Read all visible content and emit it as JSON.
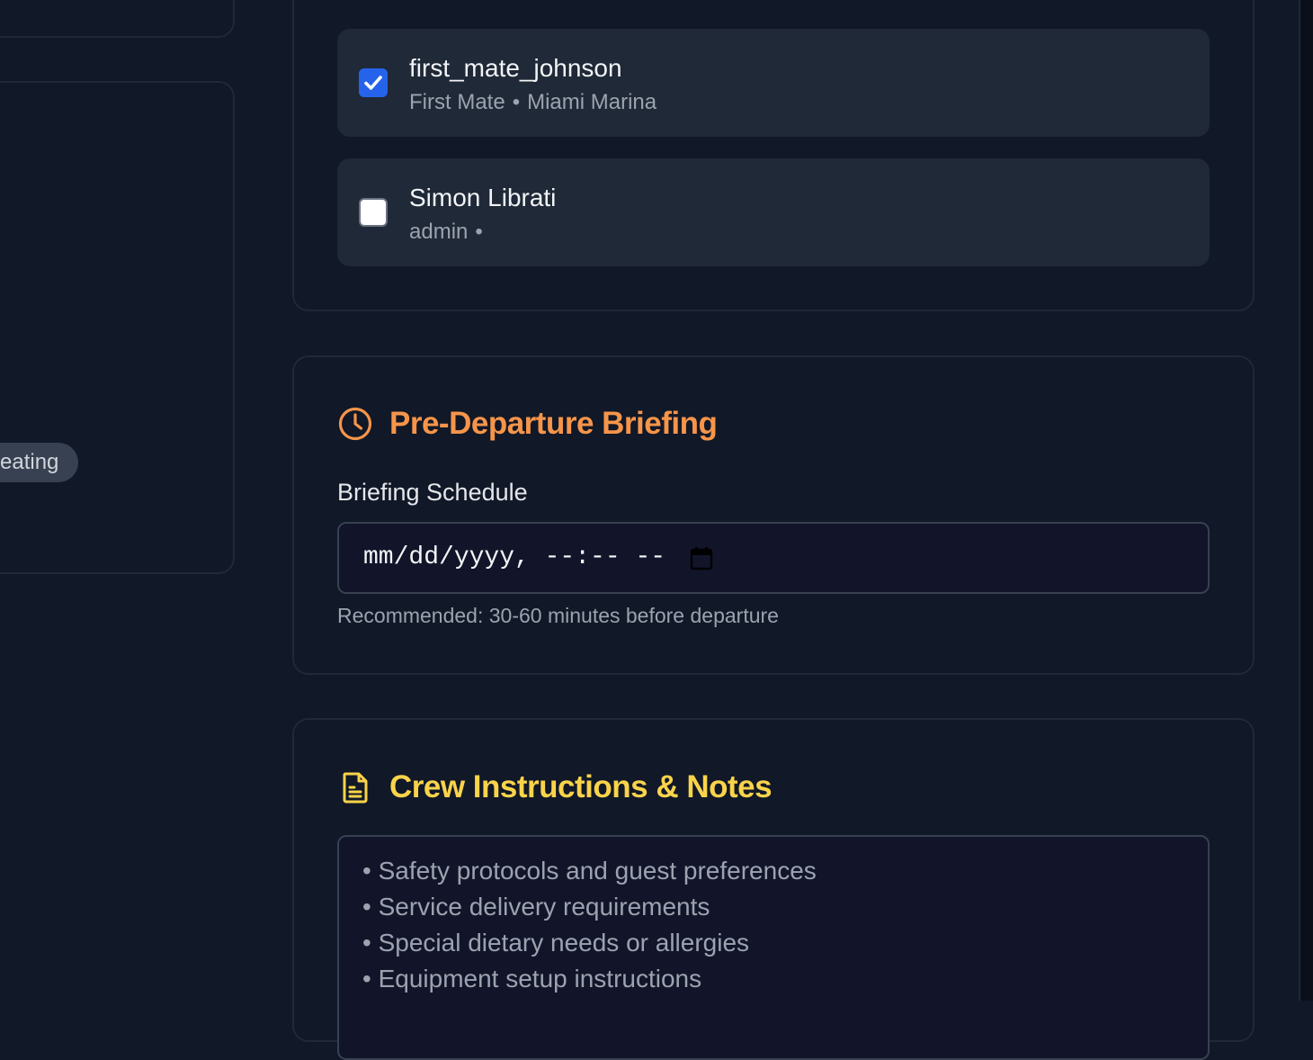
{
  "left_panel": {
    "tag_label": "eating"
  },
  "crew": {
    "members": [
      {
        "name": "first_mate_johnson",
        "role": "First Mate",
        "separator": "•",
        "location": "Miami Marina",
        "selected": true
      },
      {
        "name": "Simon Librati",
        "role": "admin",
        "separator": "•",
        "location": "",
        "selected": false
      }
    ]
  },
  "briefing": {
    "title": "Pre-Departure Briefing",
    "icon": "clock-icon",
    "field_label": "Briefing Schedule",
    "input_placeholder": "mm/dd/yyyy, --:-- --",
    "hint": "Recommended: 30-60 minutes before departure"
  },
  "notes": {
    "title": "Crew Instructions & Notes",
    "icon": "document-icon",
    "placeholder_lines": [
      "• Safety protocols and guest preferences",
      "• Service delivery requirements",
      "• Special dietary needs or allergies",
      "• Equipment setup instructions"
    ]
  },
  "colors": {
    "background": "#111827",
    "card_border": "#1f2937",
    "briefing_accent": "#f6954a",
    "notes_accent": "#f9d34a",
    "checkbox_checked": "#2563eb"
  }
}
